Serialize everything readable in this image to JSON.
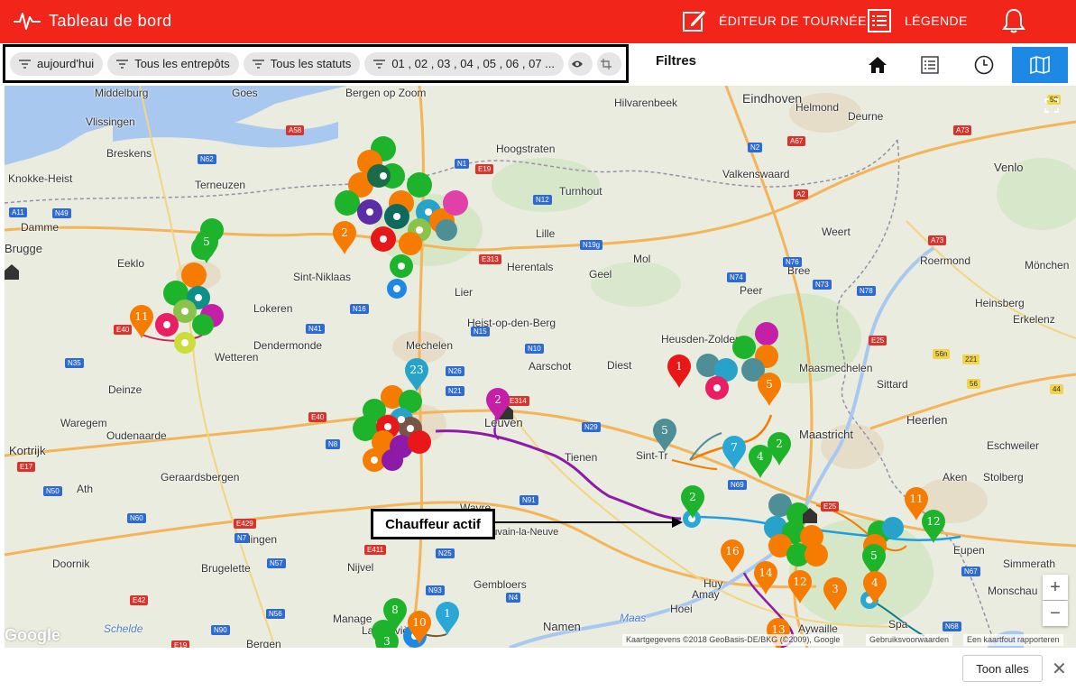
{
  "header": {
    "title": "Tableau de bord",
    "nav": [
      {
        "label": "ÉDITEUR DE TOURNÉE",
        "icon": "edit-icon"
      },
      {
        "label": "LÉGENDE",
        "icon": "list-icon"
      }
    ],
    "notification_icon": "bell-icon",
    "logo_icon": "pulse-icon"
  },
  "filters": {
    "chips": [
      {
        "label": "aujourd'hui",
        "icon": "filter-icon"
      },
      {
        "label": "Tous les entrepôts",
        "icon": "filter-icon"
      },
      {
        "label": "Tous les statuts",
        "icon": "filter-icon"
      },
      {
        "label": "01 , 02 , 03 , 04 , 05 , 06 , 07 ...",
        "icon": "filter-icon"
      }
    ],
    "toggle_icons": [
      "eye-icon",
      "crop-icon"
    ],
    "caption": "Filtres"
  },
  "view_switcher": [
    {
      "icon": "home-icon",
      "active": false
    },
    {
      "icon": "list-view-icon",
      "active": false
    },
    {
      "icon": "clock-icon",
      "active": false
    },
    {
      "icon": "map-icon",
      "active": true
    }
  ],
  "map": {
    "labels": [
      "Middelburg",
      "Goes",
      "Bergen op Zoom",
      "Hilvarenbeek",
      "Eindhoven",
      "Helmond",
      "Deurne",
      "Vlissingen",
      "Breskens",
      "Knokke-Heist",
      "Terneuzen",
      "Hoogstraten",
      "Turnhout",
      "Valkenswaard",
      "Venlo",
      "Damme",
      "Brugge",
      "Eeklo",
      "Lille",
      "Weert",
      "Roermond",
      "Mönchen",
      "Sint-Niklaas",
      "Herentals",
      "Geel",
      "Mol",
      "Lokeren",
      "Lier",
      "Bree",
      "Heist-op-den-Berg",
      "Peer",
      "Heinsberg",
      "Erkelenz",
      "Dendermonde",
      "Mechelen",
      "Heusden-Zolder",
      "Wetteren",
      "Aarschot",
      "Diest",
      "Maasmechelen",
      "Sittard",
      "Deinze",
      "Leuven",
      "Heerlen",
      "Waregem",
      "Oudenaarde",
      "Tienen",
      "Sint-Tr",
      "Maastricht",
      "Eschweiler",
      "Kortrijk",
      "Geraardsbergen",
      "Aken",
      "Stolberg",
      "Wavre",
      "Ottignies-Louvain-la-Neuve",
      "Eupen",
      "Doornik",
      "Brugelette",
      "Nijvel",
      "Gembloers",
      "Amay",
      "Huy",
      "Simmerath",
      "Monschau",
      "Manage",
      "La Louvière",
      "Namen",
      "Hoei",
      "Aywaille",
      "Spa",
      "Bergen",
      "Maas",
      "Schelde",
      "Edingen",
      "Ath"
    ],
    "roads": [
      "A58",
      "N62",
      "N1",
      "E19",
      "N12",
      "N2",
      "A67",
      "A73",
      "A11",
      "N49",
      "A2",
      "N19g",
      "A73",
      "E313",
      "N74",
      "N76",
      "N73",
      "N78",
      "N16",
      "N41",
      "E40",
      "N15",
      "N10",
      "E25",
      "56n",
      "221",
      "56",
      "44",
      "N35",
      "N26",
      "N21",
      "E314",
      "N29",
      "N8",
      "E40",
      "N69",
      "E25",
      "E17",
      "N50",
      "E429",
      "N7",
      "N60",
      "N91",
      "N25",
      "E411",
      "N57",
      "N4",
      "N93",
      "N67",
      "E42",
      "E19",
      "N56",
      "N90",
      "N68",
      "58"
    ],
    "pins": [
      {
        "label": "11",
        "color": "#f57c00"
      },
      {
        "label": "2",
        "color": "#f57c00"
      },
      {
        "label": "5",
        "color": "#1db32a"
      },
      {
        "label": "2",
        "color": "#c51fa8"
      },
      {
        "label": "23",
        "color": "#27a3c9"
      },
      {
        "label": "1",
        "color": "#e81818"
      },
      {
        "label": "5",
        "color": "#f57c00"
      },
      {
        "label": "5",
        "color": "#4e8e96"
      },
      {
        "label": "7",
        "color": "#29a8d6"
      },
      {
        "label": "4",
        "color": "#1db32a"
      },
      {
        "label": "2",
        "color": "#1db32a"
      },
      {
        "label": "2",
        "color": "#1db32a"
      },
      {
        "label": "16",
        "color": "#f57c00"
      },
      {
        "label": "14",
        "color": "#f57c00"
      },
      {
        "label": "12",
        "color": "#f57c00"
      },
      {
        "label": "3",
        "color": "#f57c00"
      },
      {
        "label": "11",
        "color": "#f57c00"
      },
      {
        "label": "12",
        "color": "#1db32a"
      },
      {
        "label": "5",
        "color": "#1db32a"
      },
      {
        "label": "4",
        "color": "#f57c00"
      },
      {
        "label": "8",
        "color": "#1db32a"
      },
      {
        "label": "10",
        "color": "#f57c00"
      },
      {
        "label": "1",
        "color": "#29a8d6"
      },
      {
        "label": "3",
        "color": "#1db32a"
      },
      {
        "label": "13",
        "color": "#f57c00"
      }
    ],
    "google_logo": "Google",
    "attribution": [
      "Kaartgegevens ©2018 GeoBasis-DE/BKG (©2009), Google",
      "Gebruiksvoorwaarden",
      "Een kaartfout rapporteren"
    ],
    "controls": [
      "fullscreen-icon",
      "zoom-in-icon",
      "zoom-out-icon"
    ],
    "callout": "Chauffeur actif"
  },
  "footer": {
    "show_all": "Toon alles",
    "close": "✕"
  },
  "colors": {
    "brand": "#f2251b",
    "active_view": "#1e88e5",
    "route_purple": "#8e1aa8",
    "route_blue": "#1e9ee0",
    "route_orange": "#f57c00"
  }
}
